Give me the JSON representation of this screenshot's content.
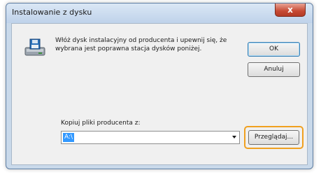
{
  "window": {
    "title": "Instalowanie z dysku",
    "close_label": "x"
  },
  "dialog": {
    "message": "Włóż dysk instalacyjny od producenta i upewnij się, że wybrana jest poprawna stacja dysków poniżej.",
    "ok_label": "OK",
    "cancel_label": "Anuluj",
    "copy_label": "Kopiuj pliki producenta z:",
    "path_value": "A:\\",
    "browse_label": "Przeglądaj..."
  },
  "colors": {
    "highlight": "#f0a020",
    "selection": "#3399ff",
    "close": "#c74a33"
  },
  "icons": {
    "disk": "disk-drive-icon",
    "dropdown": "chevron-down-icon"
  }
}
